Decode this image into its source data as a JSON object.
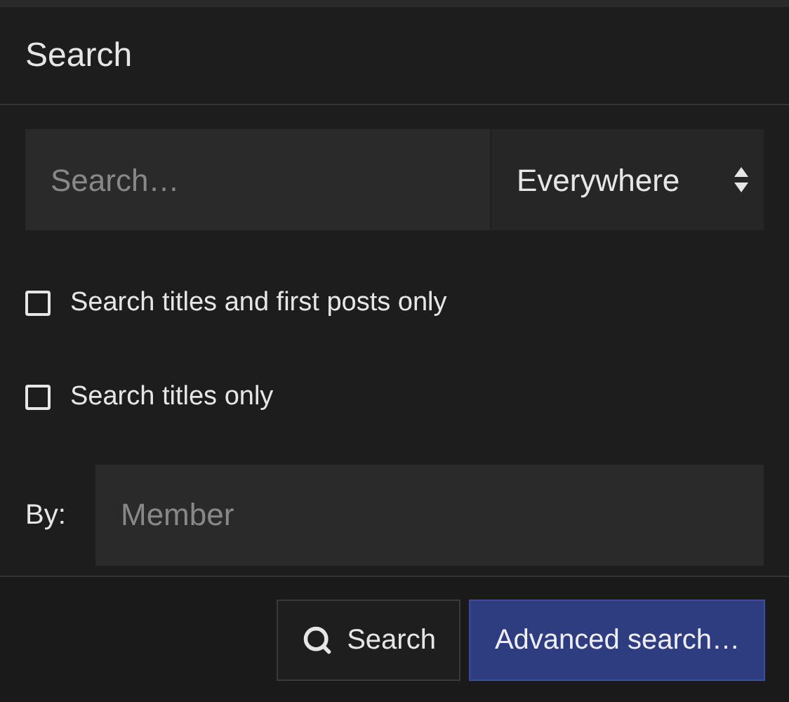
{
  "header": {
    "title": "Search"
  },
  "search": {
    "placeholder": "Search…",
    "scope": "Everywhere"
  },
  "options": [
    {
      "label": "Search titles and first posts only",
      "checked": false
    },
    {
      "label": "Search titles only",
      "checked": false
    }
  ],
  "by": {
    "label": "By:",
    "placeholder": "Member"
  },
  "buttons": [
    {
      "label": "Search",
      "kind": "secondary"
    },
    {
      "label": "Advanced search…",
      "kind": "primary"
    }
  ]
}
